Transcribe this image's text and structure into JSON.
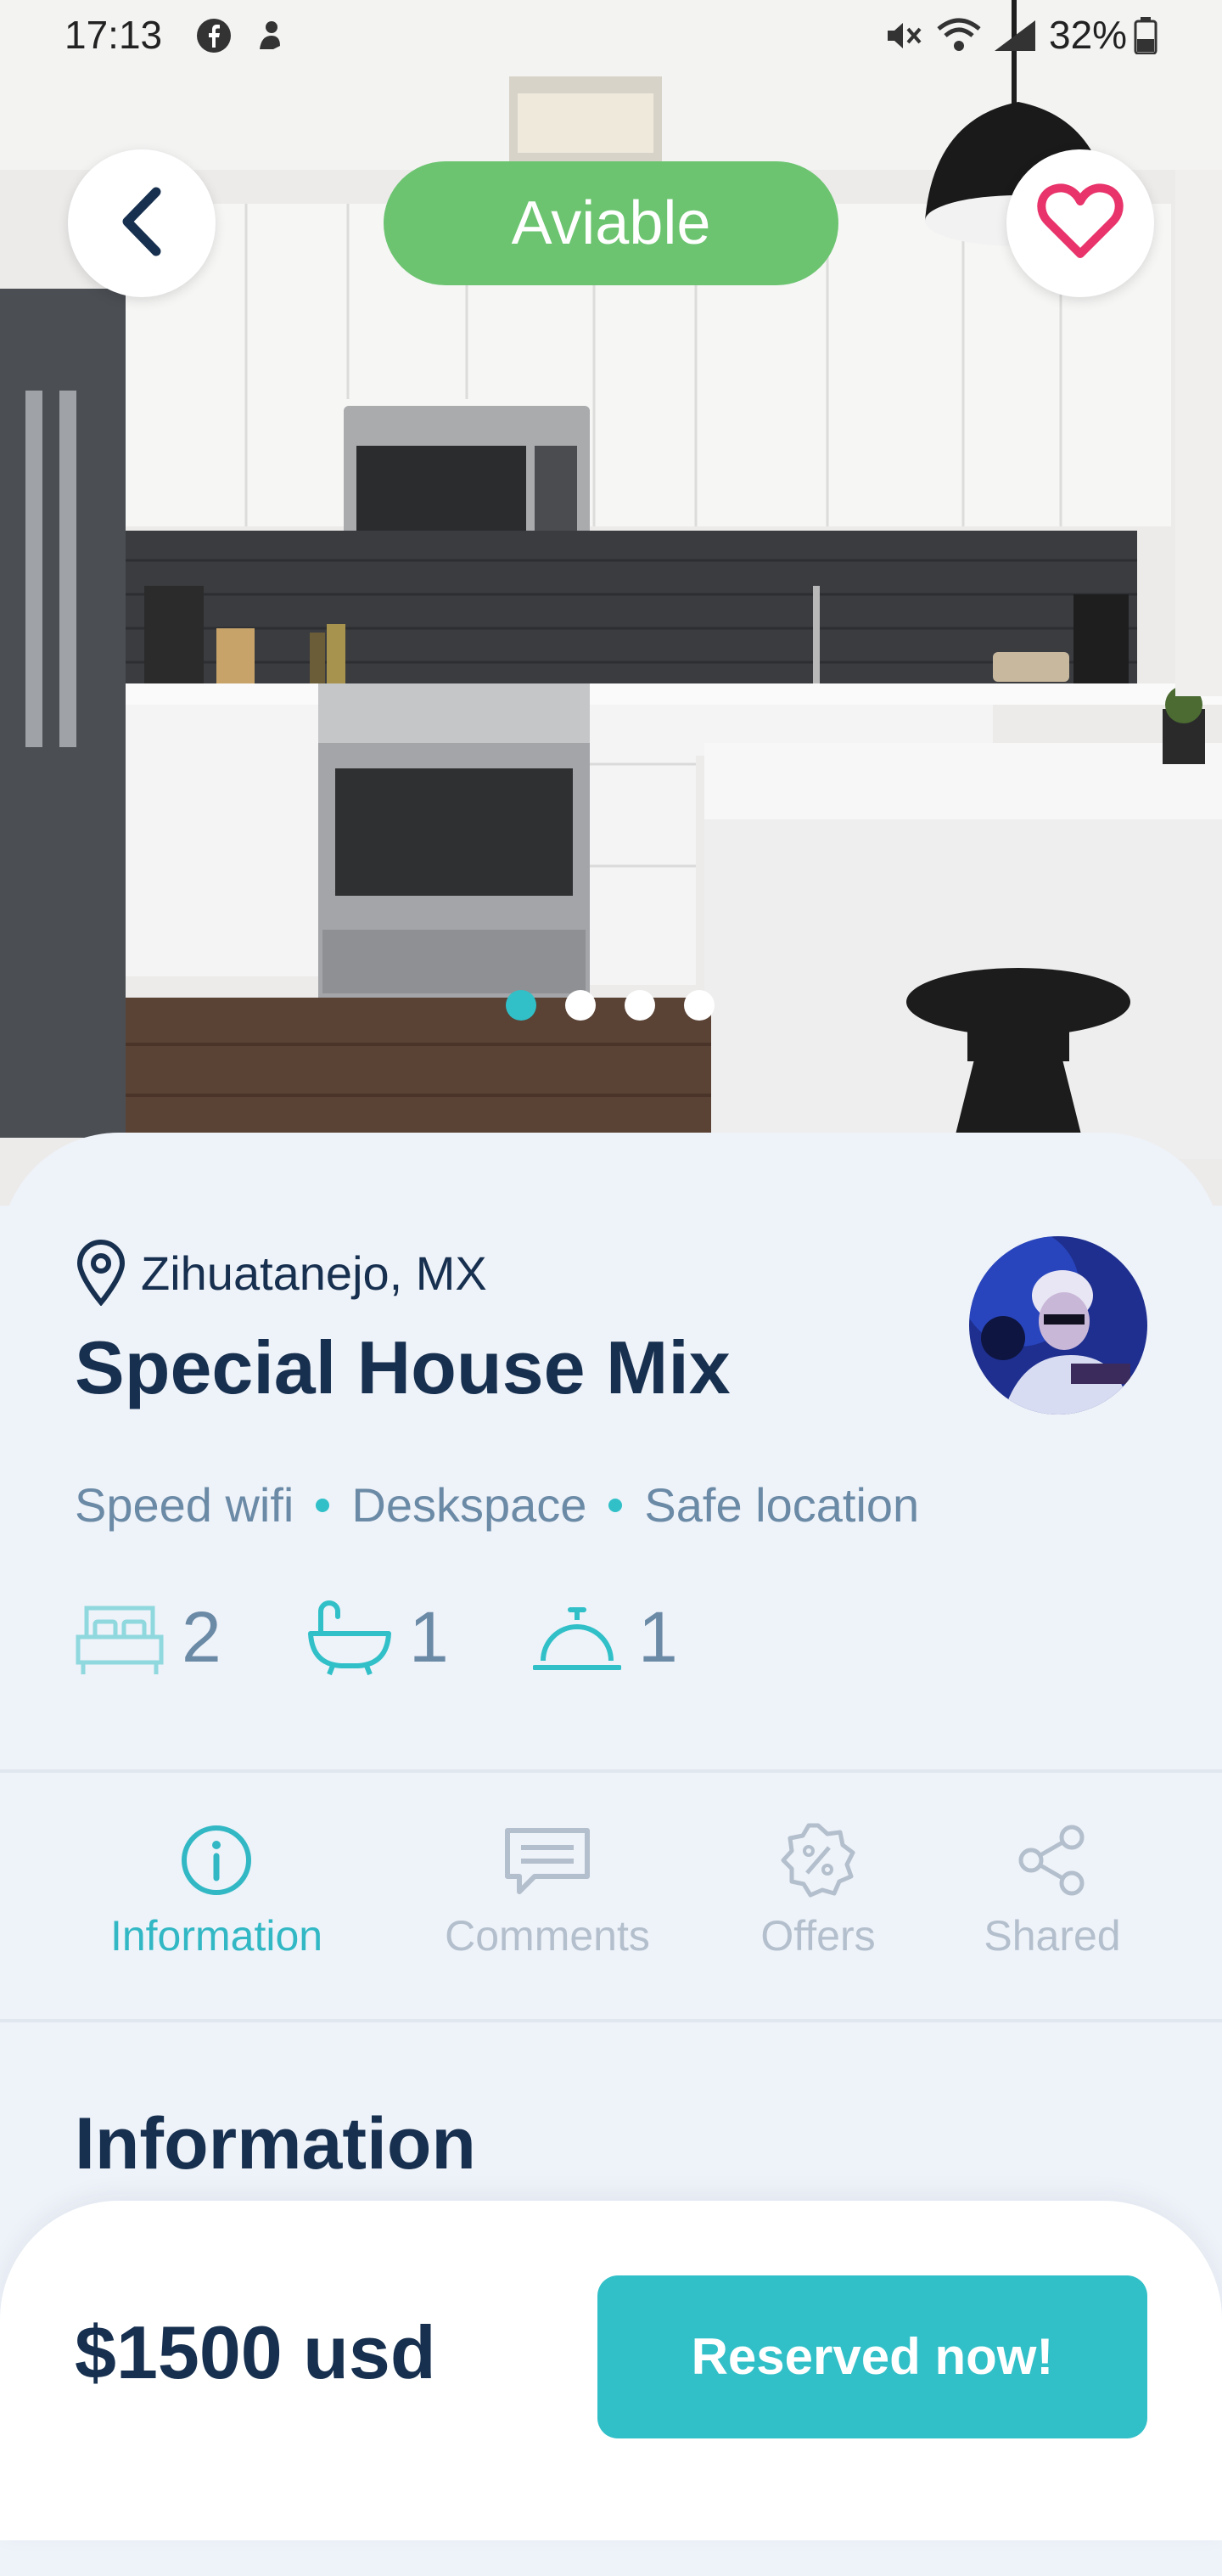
{
  "status_bar": {
    "time": "17:13",
    "battery": "32%",
    "icons": [
      "facebook-icon",
      "notification-icon",
      "mute-icon",
      "wifi-icon",
      "signal-icon",
      "battery-icon"
    ]
  },
  "hero": {
    "availability_label": "Aviable",
    "back_icon": "chevron-left-icon",
    "favorite_icon": "heart-icon",
    "carousel": {
      "count": 4,
      "active_index": 0
    }
  },
  "listing": {
    "location": "Zihuatanejo, MX",
    "title": "Special House Mix",
    "features": [
      "Speed wifi",
      "Deskspace",
      "Safe location"
    ],
    "amenities": [
      {
        "icon": "bed-icon",
        "count": "2"
      },
      {
        "icon": "bathtub-icon",
        "count": "1"
      },
      {
        "icon": "service-bell-icon",
        "count": "1"
      }
    ]
  },
  "tabs": [
    {
      "label": "Information",
      "icon": "info-icon",
      "active": true
    },
    {
      "label": "Comments",
      "icon": "comment-icon",
      "active": false
    },
    {
      "label": "Offers",
      "icon": "discount-icon",
      "active": false
    },
    {
      "label": "Shared",
      "icon": "share-icon",
      "active": false
    }
  ],
  "section": {
    "title": "Information"
  },
  "footer": {
    "price": "$1500 usd",
    "reserve_label": "Reserved now!"
  },
  "colors": {
    "accent": "#31c0c8",
    "available": "#6cc470",
    "heading": "#17304f",
    "muted": "#6b8aa6",
    "heart": "#e8336b"
  }
}
